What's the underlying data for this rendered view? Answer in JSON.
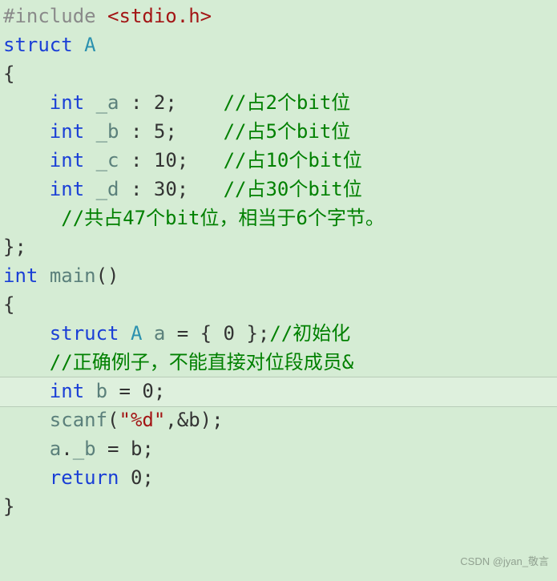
{
  "watermark": "CSDN @jyan_敬言",
  "code": {
    "include_hash": "#include ",
    "include_file": "<stdio.h>",
    "struct_kw": "struct",
    "struct_name": "A",
    "open_brace": "{",
    "close_brace_semi": "};",
    "int_kw": "int",
    "m1_name": "_a",
    "m1_bits": "2",
    "m1_cmt": "//占2个bit位",
    "m2_name": "_b",
    "m2_bits": "5",
    "m2_cmt": "//占5个bit位",
    "m3_name": "_c",
    "m3_bits": "10",
    "m3_cmt": "//占10个bit位",
    "m4_name": "_d",
    "m4_bits": "30",
    "m4_cmt": "//占30个bit位",
    "sum_cmt": "//共占47个bit位，相当于6个字节。",
    "main_name": "main",
    "main_open": "{",
    "main_close": "}",
    "decl_struct_kw": "struct",
    "decl_type": "A",
    "decl_var": "a",
    "decl_init": " = { 0 };",
    "decl_cmt": "//初始化",
    "note_cmt": "//正确例子，不能直接对位段成员&",
    "b_decl_name": "b",
    "b_decl_init": " = 0;",
    "scanf_name": "scanf",
    "scanf_open": "(",
    "scanf_fmt": "\"%d\"",
    "scanf_rest": ",&b);",
    "assign_lhs_obj": "a",
    "assign_lhs_dot": ".",
    "assign_lhs_mem": "_b",
    "assign_rest": " = b;",
    "return_kw": "return",
    "return_val": " 0;"
  }
}
